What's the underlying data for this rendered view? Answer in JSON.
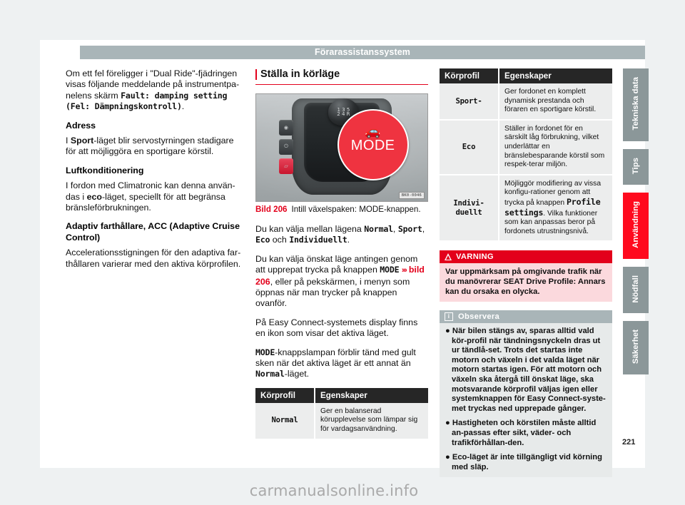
{
  "header": {
    "title": "Förarassistanssystem"
  },
  "page_number": "221",
  "watermark": "carmanualsonline.info",
  "col1": {
    "para1_a": "Om ett fel föreligger i \"Dual Ride\"-fjädringen visas följande meddelande på instrumentpa-nelens skärm ",
    "para1_mono": "Fault: damping setting (Fel: Dämpningskontroll)",
    "para1_end": ".",
    "h_adress": "Adress",
    "para2_a": "I ",
    "para2_b": "Sport",
    "para2_c": "-läget blir servostyrningen stadigare för att möjliggöra en sportigare körstil.",
    "h_luft": "Luftkonditionering",
    "para3_a": "I fordon med Climatronic kan denna använ-das i ",
    "para3_b": "eco",
    "para3_c": "-läget, speciellt för att begränsa bränsleförbrukningen.",
    "h_acc": "Adaptiv farthållare, ACC (Adaptive Cruise Control)",
    "para4": "Accelerationsstigningen för den adaptiva far-thållaren varierar med den aktiva körprofilen."
  },
  "col2": {
    "section_heading": "Ställa in körläge",
    "figure": {
      "caption_num": "Bild 206",
      "caption_text": "Intill växelspaken: MODE-knappen.",
      "photo_code": "BK0-0046",
      "callout_label": "MODE",
      "knob_pattern": "1 3 5\n2 4 R"
    },
    "para1_a": "Du kan välja mellan lägena ",
    "para1_m1": "Normal",
    "para1_b": ", ",
    "para1_m2": "Sport",
    "para1_c": ", ",
    "para1_m3": "Eco",
    "para1_d": " och ",
    "para1_m4": "Individuellt",
    "para1_e": ".",
    "para2_a": "Du kan välja önskat läge antingen genom att upprepat trycka på knappen ",
    "para2_m": "MODE",
    "para2_arrows": "›››",
    "para2_ref": "bild 206",
    "para2_b": ", eller på pekskärmen, i menyn som öppnas när man trycker på knappen ovanför.",
    "para3": "På Easy Connect-systemets display finns en ikon som visar det aktiva läget.",
    "para4_m": "MODE",
    "para4_a": "-knappslampan förblir tänd med gult sken när det aktiva läget är ett annat än ",
    "para4_m2": "Normal",
    "para4_b": "-läget.",
    "table": {
      "headers": [
        "Körprofil",
        "Egenskaper"
      ],
      "rows": [
        {
          "mode": "Normal",
          "desc": "Ger en balanserad körupplevelse som lämpar sig för vardagsanvändning."
        }
      ]
    }
  },
  "col3": {
    "table": {
      "headers": [
        "Körprofil",
        "Egenskaper"
      ],
      "rows": [
        {
          "mode": "Sport-",
          "desc": "Ger fordonet en komplett dynamisk prestanda och föraren en sportigare körstil."
        },
        {
          "mode": "Eco",
          "desc": "Ställer in fordonet för en särskilt låg förbrukning, vilket underlättar en bränslebesparande körstil som respek-terar miljön."
        },
        {
          "mode": "Indivi-\nduellt",
          "desc_a": "Möjliggör modifiering av vissa konfigu-rationer genom att trycka på knappen ",
          "desc_mono": "Profile settings",
          "desc_b": ". Vilka funktioner som kan anpassas beror på fordonets utrustningsnivå."
        }
      ]
    },
    "warning": {
      "title": "VARNING",
      "text": "Var uppmärksam på omgivande trafik när du manövrerar SEAT Drive Profile: Annars kan du orsaka en olycka."
    },
    "note": {
      "title": "Observera",
      "bullets": [
        "● När bilen stängs av, sparas alltid vald kör-profil när tändningsnyckeln dras ut ur tändlå-set. Trots det startas inte motorn och växeln i det valda läget när motorn startas igen. För att motorn och växeln ska återgå till önskat läge, ska motsvarande körprofil väljas igen eller systemknappen för Easy Connect-syste-met tryckas ned upprepade gånger.",
        "● Hastigheten och körstilen måste alltid an-passas efter sikt, väder- och trafikförhållan-den.",
        "● Eco-läget är inte tillgängligt vid körning med släp."
      ]
    }
  },
  "rail": {
    "tabs": [
      {
        "label": "Tekniska data",
        "active": false
      },
      {
        "label": "Tips",
        "active": false
      },
      {
        "label": "Användning",
        "active": true
      },
      {
        "label": "Nödfall",
        "active": false
      },
      {
        "label": "Säkerhet",
        "active": false
      }
    ]
  },
  "colors": {
    "accent_red": "#e3001b",
    "tab_active": "#ff0a1e",
    "tab_inactive": "#8b9799",
    "header_bar": "#a9b5b8"
  }
}
